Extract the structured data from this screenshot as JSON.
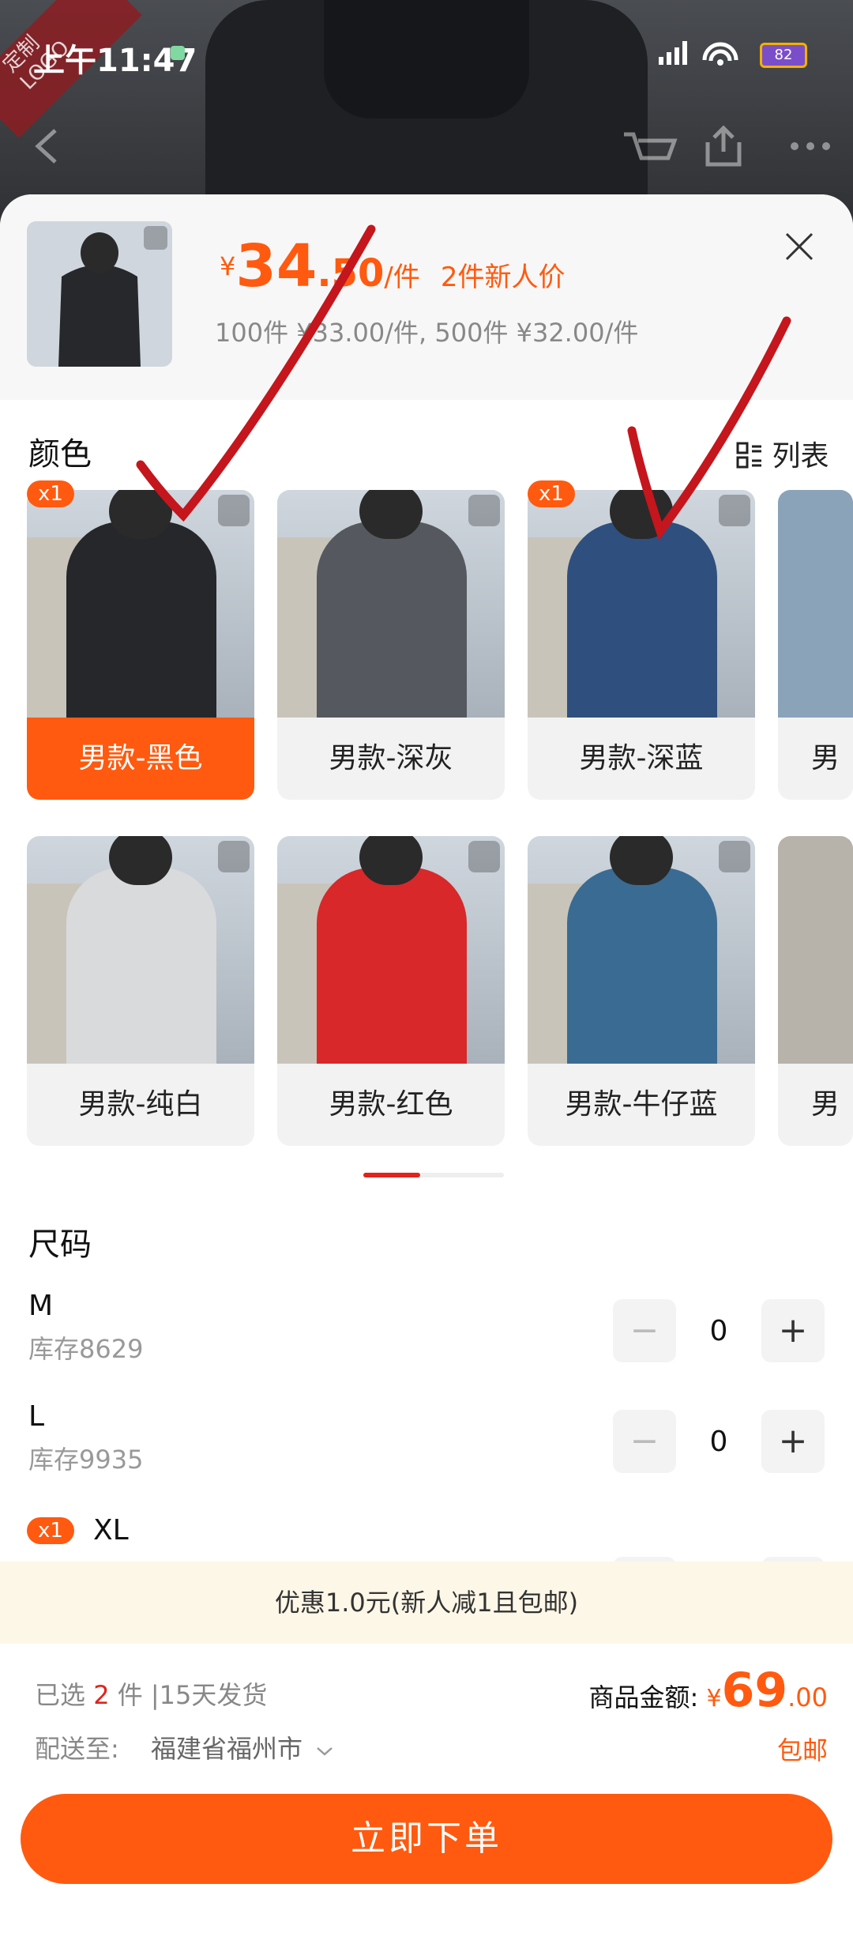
{
  "status_bar": {
    "time": "上午11:47",
    "battery": "82"
  },
  "watermark": "定制LOGO",
  "header": {
    "price_currency": "¥",
    "price_int": "34",
    "price_dec": ".50",
    "price_unit": "/件",
    "price_tag": "2件新人价",
    "tiers": "100件 ¥33.00/件, 500件 ¥32.00/件"
  },
  "color_section": {
    "title": "颜色",
    "list_label": "列表",
    "items": [
      {
        "label": "男款-黑色",
        "badge": "x1",
        "selected": true,
        "color": "#25272b"
      },
      {
        "label": "男款-深灰",
        "badge": "",
        "selected": false,
        "color": "#55585e"
      },
      {
        "label": "男款-深蓝",
        "badge": "x1",
        "selected": false,
        "color": "#2f4f7f"
      },
      {
        "label": "男款-纯白",
        "badge": "",
        "selected": false,
        "color": "#d9dadc"
      },
      {
        "label": "男款-红色",
        "badge": "",
        "selected": false,
        "color": "#d8282a"
      },
      {
        "label": "男款-牛仔蓝",
        "badge": "",
        "selected": false,
        "color": "#3a6b93"
      }
    ],
    "partial_label": "男"
  },
  "size_section": {
    "title": "尺码",
    "sizes": [
      {
        "name": "M",
        "stock": "库存8629",
        "qty": "0"
      },
      {
        "name": "L",
        "stock": "库存9935",
        "qty": "0"
      },
      {
        "name": "XL",
        "badge": "x1",
        "qty": "1"
      }
    ]
  },
  "promo": "优惠1.0元(新人减1且包邮)",
  "footer": {
    "selected_prefix": "已选",
    "selected_count": "2",
    "selected_suffix": "件 |15天发货",
    "total_label": "商品金额:",
    "total_currency": "¥",
    "total_int": "69",
    "total_dec": ".00",
    "ship_label": "配送至:",
    "ship_city": "福建省福州市",
    "free_shipping": "包邮",
    "order_button": "立即下单"
  },
  "colors": {
    "accent": "#ff5a0f",
    "red": "#e0231b",
    "promo_bg": "#fdf7e7"
  }
}
